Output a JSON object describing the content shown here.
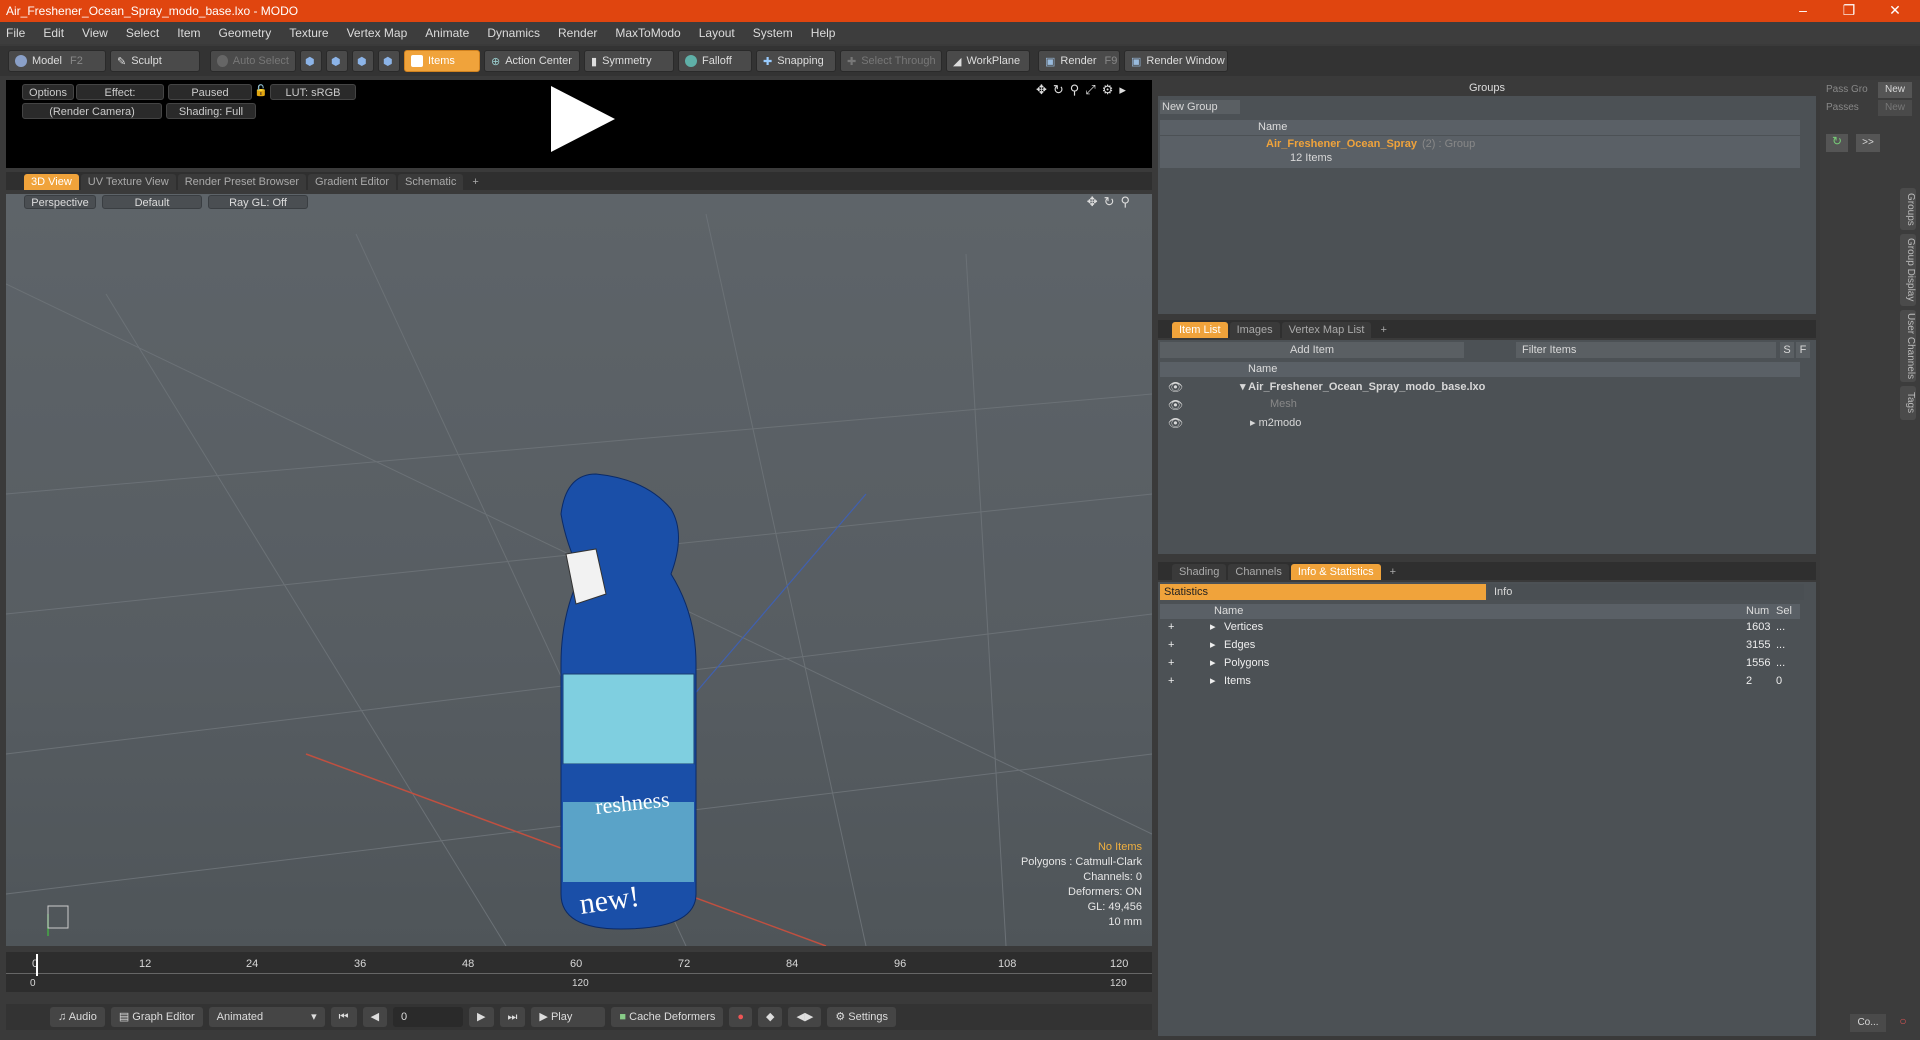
{
  "window": {
    "title": "Air_Freshener_Ocean_Spray_modo_base.lxo - MODO"
  },
  "menu": [
    "File",
    "Edit",
    "View",
    "Select",
    "Item",
    "Geometry",
    "Texture",
    "Vertex Map",
    "Animate",
    "Dynamics",
    "Render",
    "MaxToModo",
    "Layout",
    "System",
    "Help"
  ],
  "toolbar": {
    "model": "Model",
    "model_key": "F2",
    "sculpt": "Sculpt",
    "auto_select": "Auto Select",
    "items": "Items",
    "action_center": "Action Center",
    "symmetry": "Symmetry",
    "falloff": "Falloff",
    "snapping": "Snapping",
    "select_through": "Select Through",
    "workplane": "WorkPlane",
    "render": "Render",
    "render_key": "F9",
    "render_window": "Render Window"
  },
  "preview": {
    "options": "Options",
    "effect": "Effect: (Shadi...",
    "paused": "Paused",
    "lut": "LUT: sRGB",
    "camera": "(Render Camera)",
    "shading": "Shading: Full"
  },
  "viewport_tabs": [
    "3D View",
    "UV Texture View",
    "Render Preset Browser",
    "Gradient Editor",
    "Schematic",
    "+"
  ],
  "viewport_bar": {
    "perspective": "Perspective",
    "default": "Default",
    "raygl": "Ray GL: Off"
  },
  "viewport_info": {
    "no_items": "No Items",
    "polygons": "Polygons : Catmull-Clark",
    "channels": "Channels: 0",
    "deformers": "Deformers: ON",
    "gl": "GL: 49,456",
    "units": "10 mm"
  },
  "timeline": {
    "ticks": [
      "0",
      "12",
      "24",
      "36",
      "48",
      "60",
      "72",
      "84",
      "96",
      "108",
      "120"
    ],
    "start": "0",
    "mid": "120",
    "end": "120"
  },
  "bottombar": {
    "audio": "Audio",
    "graph_editor": "Graph Editor",
    "animated": "Animated",
    "frame": "0",
    "play": "Play",
    "cache": "Cache Deformers",
    "settings": "Settings"
  },
  "groups": {
    "title": "Groups",
    "new_group": "New Group",
    "col_name": "Name",
    "group_name": "Air_Freshener_Ocean_Spray",
    "group_suffix": "(2) : Group",
    "group_count": "12 Items"
  },
  "pass": {
    "label1": "Pass Gro",
    "label2": "Passes",
    "new1": "New",
    "new2": "New"
  },
  "item_tabs": [
    "Item List",
    "Images",
    "Vertex Map List",
    "+"
  ],
  "items": {
    "add_item": "Add Item",
    "filter": "Filter Items",
    "s": "S",
    "f": "F",
    "col_name": "Name",
    "rows": [
      "Air_Freshener_Ocean_Spray_modo_base.lxo",
      "Mesh",
      "m2modo"
    ]
  },
  "stats_tabs": [
    "Shading",
    "Channels",
    "Info & Statistics",
    "+"
  ],
  "stats": {
    "statistics": "Statistics",
    "info": "Info",
    "col_name": "Name",
    "col_num": "Num",
    "col_sel": "Sel",
    "rows": [
      {
        "name": "Vertices",
        "num": "1603",
        "sel": "..."
      },
      {
        "name": "Edges",
        "num": "3155",
        "sel": "..."
      },
      {
        "name": "Polygons",
        "num": "1556",
        "sel": "..."
      },
      {
        "name": "Items",
        "num": "2",
        "sel": "0"
      }
    ]
  },
  "side_tabs": [
    "Groups",
    "Group Display",
    "User Channels",
    "Tags"
  ],
  "corner": {
    "more": ">>",
    "co": "Co..."
  }
}
